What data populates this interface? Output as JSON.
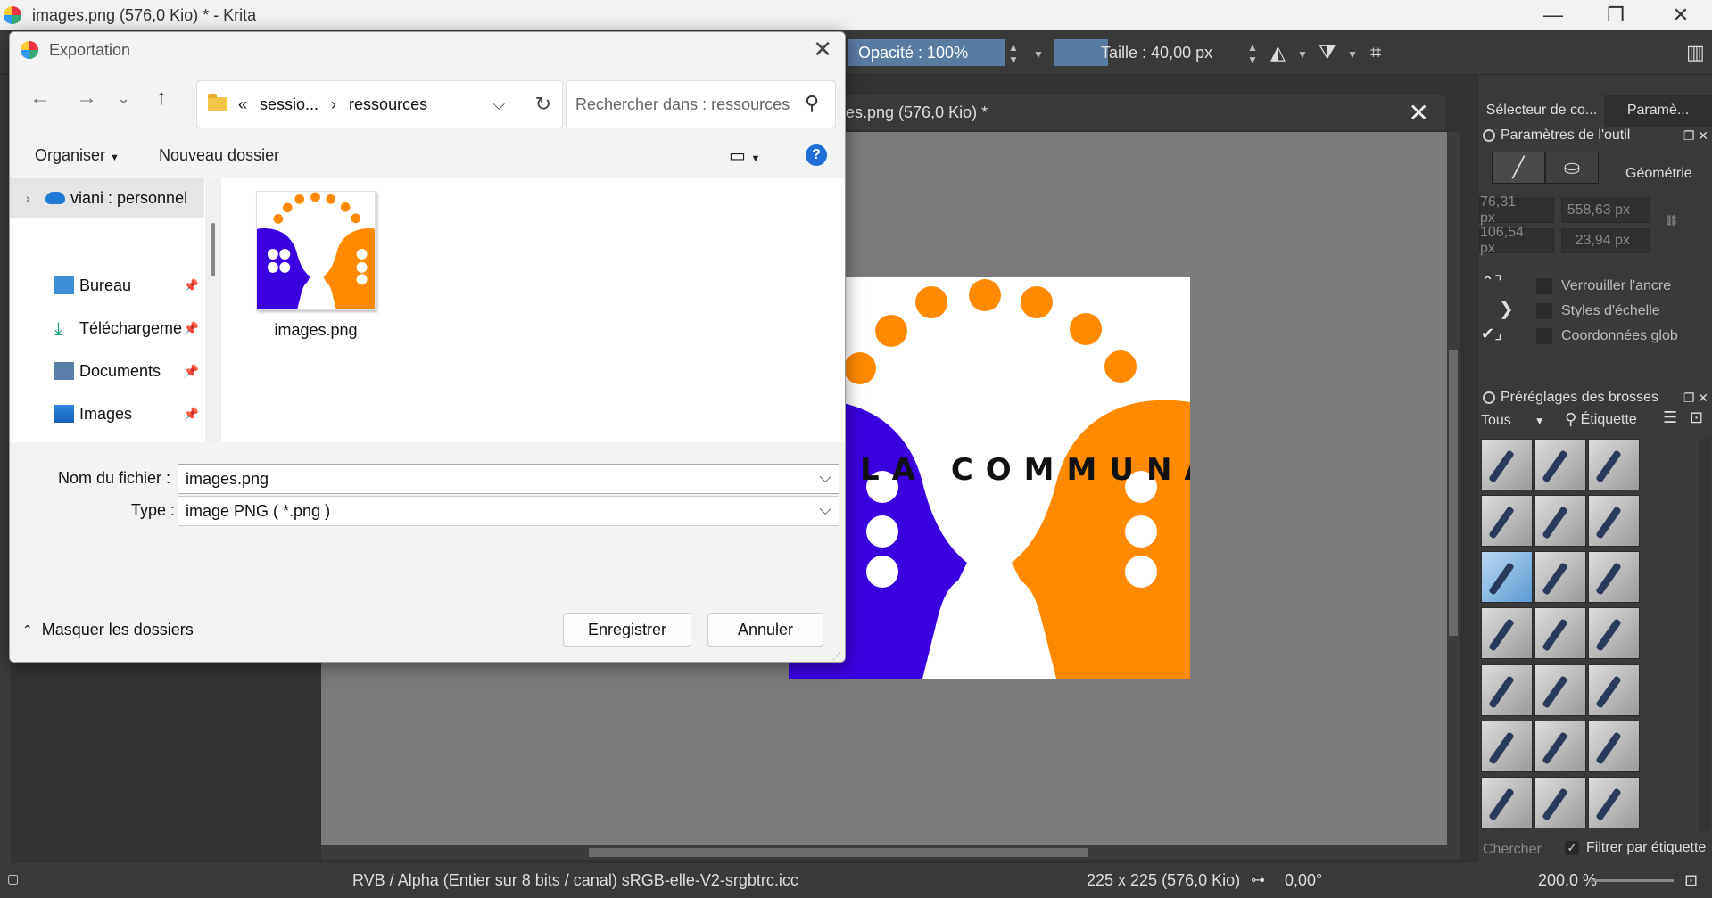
{
  "window": {
    "title": "images.png (576,0 Kio) * - Krita",
    "minimize": "—",
    "maximize": "❐",
    "close": "✕"
  },
  "toolbar": {
    "opacity_label": "Opacité : 100%",
    "size_label": "Taille :",
    "size_value": "40,00 px"
  },
  "document": {
    "tab_title": "es.png (576,0 Kio) *",
    "artwork_text": "LA COMMUNA",
    "colors": {
      "blue": "#3a00e0",
      "orange": "#ff8a00"
    }
  },
  "status": {
    "color_space": "RVB / Alpha (Entier sur 8 bits / canal)  sRGB-elle-V2-srgbtrc.icc",
    "image_size": "225 x 225 (576,0 Kio)",
    "rotation": "0,00°",
    "zoom": "200,0 %"
  },
  "docker": {
    "tabs": [
      "Sélecteur de co...",
      "Paramè..."
    ],
    "tool_options_title": "Paramètres de l'outil",
    "geometry_label": "Géométrie",
    "x": "76,31 px",
    "y": "106,54 px",
    "w": "558,63 px",
    "h": "23,94 px",
    "checks": [
      "Verrouiller l'ancre",
      "Styles d'échelle",
      "Coordonnées glob"
    ],
    "brush_presets_title": "Préréglages des brosses",
    "filter_all": "Tous",
    "tag_label": "Étiquette",
    "search_placeholder": "Chercher",
    "filter_by_tag": "Filtrer par étiquette"
  },
  "dialog": {
    "title": "Exportation",
    "close": "✕",
    "address": {
      "prefix": "«",
      "part1": "sessio...",
      "sep": "›",
      "part2": "ressources"
    },
    "search_placeholder": "Rechercher dans : ressources",
    "organize": "Organiser",
    "new_folder": "Nouveau dossier",
    "help": "?",
    "nav_items": [
      {
        "label": "viani : personnel",
        "icon": "onedrive-cloud-icon"
      },
      {
        "label": "Bureau",
        "icon": "desktop-icon"
      },
      {
        "label": "Téléchargeme",
        "icon": "download-icon"
      },
      {
        "label": "Documents",
        "icon": "documents-icon"
      },
      {
        "label": "Images",
        "icon": "images-icon"
      }
    ],
    "file": {
      "name": "images.png"
    },
    "filename_label": "Nom du fichier :",
    "filename_value": "images.png",
    "type_label": "Type :",
    "type_value": "image PNG ( *.png )",
    "hide_folders": "Masquer les dossiers",
    "save": "Enregistrer",
    "cancel": "Annuler"
  }
}
